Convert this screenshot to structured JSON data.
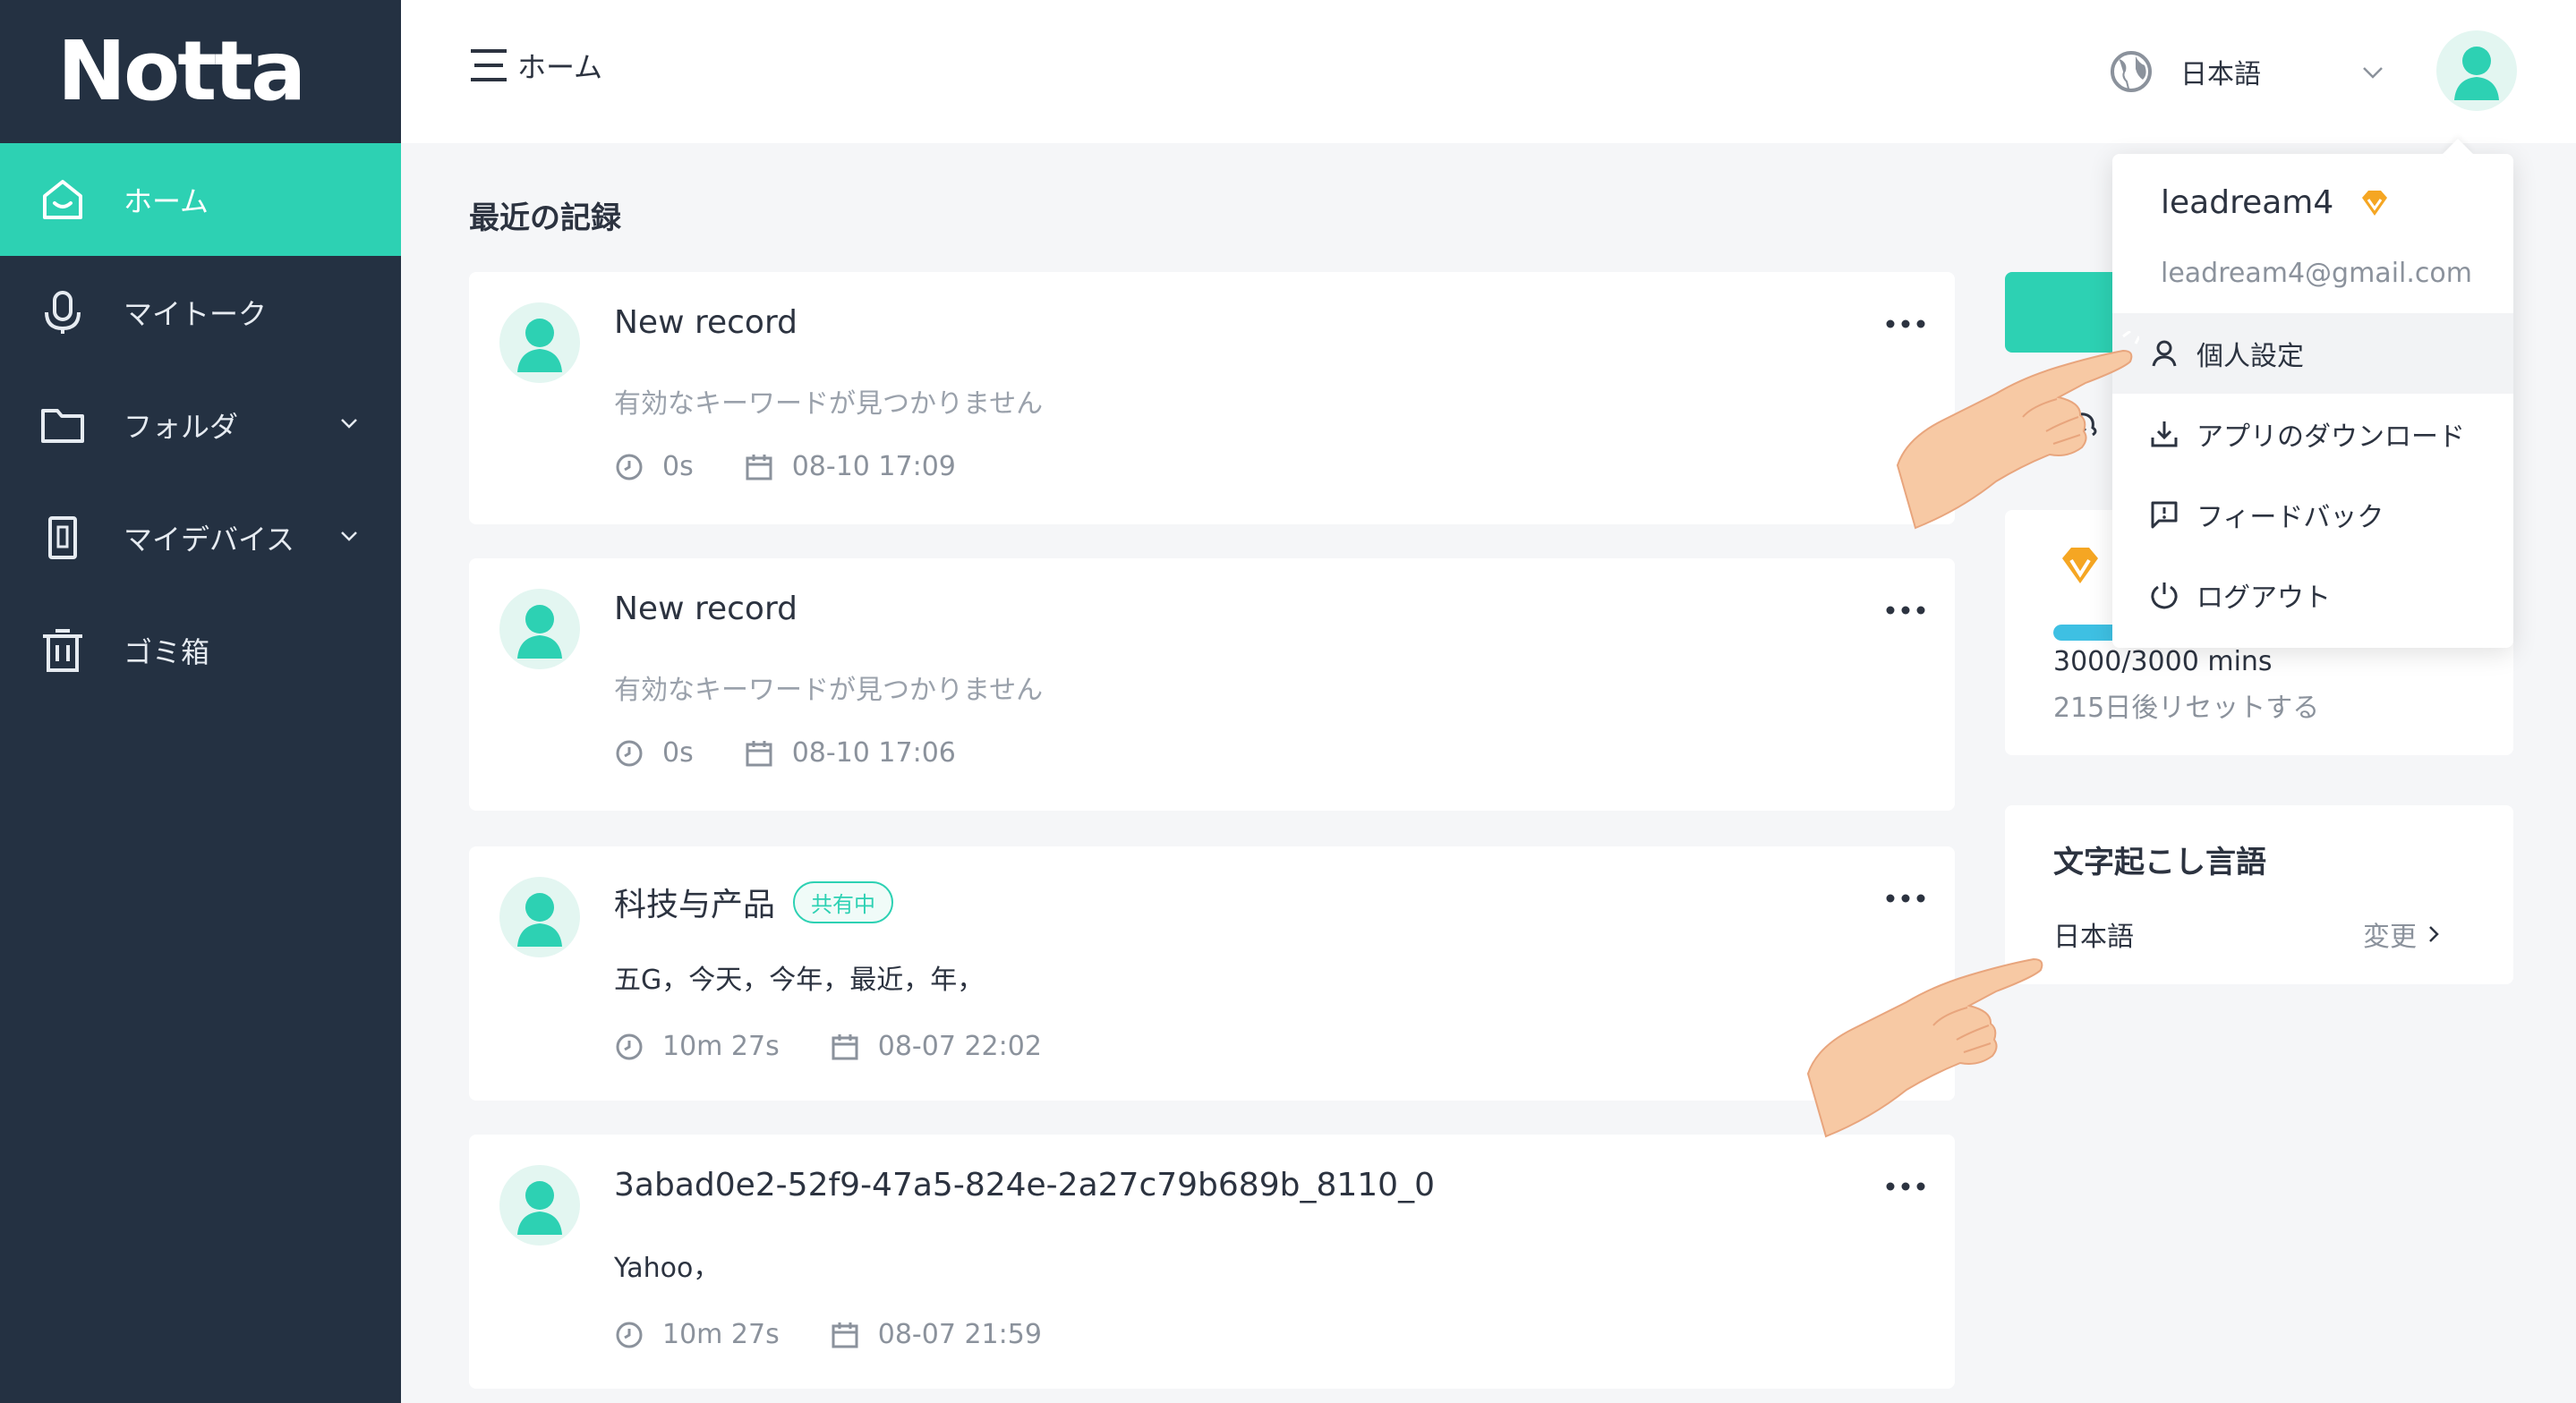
{
  "brand": {
    "name": "Notta"
  },
  "sidebar": {
    "items": [
      {
        "label": "ホーム",
        "icon": "home-icon",
        "active": true
      },
      {
        "label": "マイトーク",
        "icon": "microphone-icon"
      },
      {
        "label": "フォルダ",
        "icon": "folder-icon",
        "has_caret": true
      },
      {
        "label": "マイデバイス",
        "icon": "device-icon",
        "has_caret": true
      },
      {
        "label": "ゴミ箱",
        "icon": "trash-icon"
      }
    ]
  },
  "header": {
    "menu_label": "ホーム",
    "language": "日本語"
  },
  "main": {
    "section_title": "最近の記録",
    "records": [
      {
        "title": "New record",
        "snippet": "有効なキーワードが見つかりません",
        "duration": "0s",
        "date": "08-10 17:09"
      },
      {
        "title": "New record",
        "snippet": "有効なキーワードが見つかりません",
        "duration": "0s",
        "date": "08-10 17:06"
      },
      {
        "title": "科技与产品",
        "badge": "共有中",
        "snippet": "五G，今天，今年，最近，年，",
        "duration": "10m 27s",
        "date": "08-07 22:02"
      },
      {
        "title": "3abad0e2-52f9-47a5-824e-2a27c79b689b_8110_0",
        "snippet": "Yahoo，",
        "duration": "10m 27s",
        "date": "08-07 21:59"
      }
    ]
  },
  "plan": {
    "usage": "3000/3000 mins",
    "reset": "215日後リセットする",
    "usage_fraction": 1.0
  },
  "transcription_language": {
    "title": "文字起こし言語",
    "value": "日本語",
    "change_label": "変更"
  },
  "account_menu": {
    "username": "leadream4",
    "email": "leadream4@gmail.com",
    "items": [
      {
        "label": "個人設定",
        "icon": "user-icon"
      },
      {
        "label": "アプリのダウンロード",
        "icon": "download-icon"
      },
      {
        "label": "フィードバック",
        "icon": "feedback-icon"
      },
      {
        "label": "ログアウト",
        "icon": "power-icon"
      }
    ]
  },
  "colors": {
    "sidebar_bg": "#243142",
    "accent": "#2dd1b3",
    "progress": "#3ec0e3",
    "premium": "#f5a623"
  }
}
